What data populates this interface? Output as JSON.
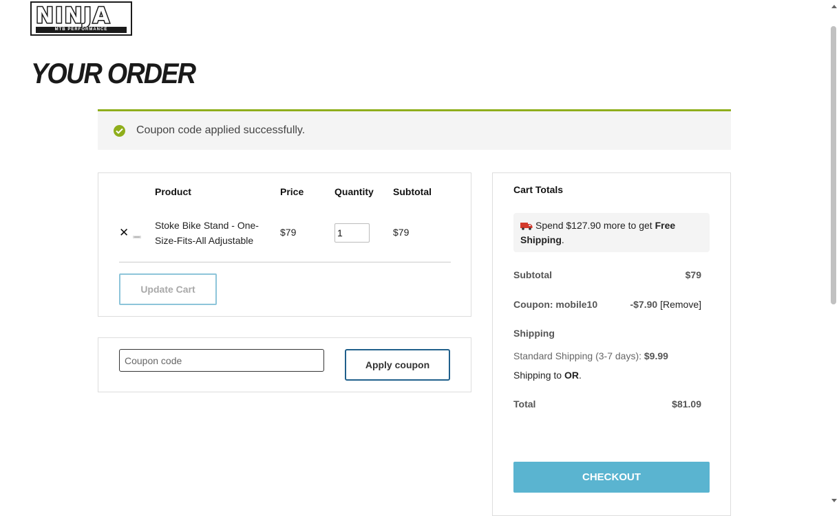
{
  "logo": {
    "text": "NINJA",
    "subtext": "MTB PERFORMANCE"
  },
  "page": {
    "title": "YOUR ORDER"
  },
  "notice": {
    "message": "Coupon code applied successfully.",
    "color": "#8fae1b",
    "icon": "check-circle-icon"
  },
  "cart": {
    "headers": {
      "product": "Product",
      "price": "Price",
      "quantity": "Quantity",
      "subtotal": "Subtotal"
    },
    "items": [
      {
        "remove": "✕",
        "name": "Stoke Bike Stand - One-Size-Fits-All Adjustable",
        "price": "$79",
        "quantity": "1",
        "subtotal": "$79"
      }
    ],
    "update_label": "Update Cart"
  },
  "coupon": {
    "placeholder": "Coupon code",
    "apply_label": "Apply coupon"
  },
  "totals": {
    "title": "Cart Totals",
    "promo": {
      "icon": "delivery-truck-icon",
      "prefix": "Spend $127.90 more to get ",
      "bold": "Free Shipping",
      "suffix": "."
    },
    "subtotal_label": "Subtotal",
    "subtotal_value": "$79",
    "coupon_label": "Coupon: mobile10",
    "coupon_value": "-$7.90",
    "coupon_remove": "[Remove]",
    "shipping_label": "Shipping",
    "shipping_method": "Standard Shipping (3-7 days): ",
    "shipping_price": "$9.99",
    "shipping_to_prefix": "Shipping to ",
    "shipping_to_state": "OR",
    "shipping_to_suffix": ".",
    "total_label": "Total",
    "total_value": "$81.09",
    "checkout_label": "CHECKOUT",
    "checkout_color": "#5ab4d0"
  }
}
